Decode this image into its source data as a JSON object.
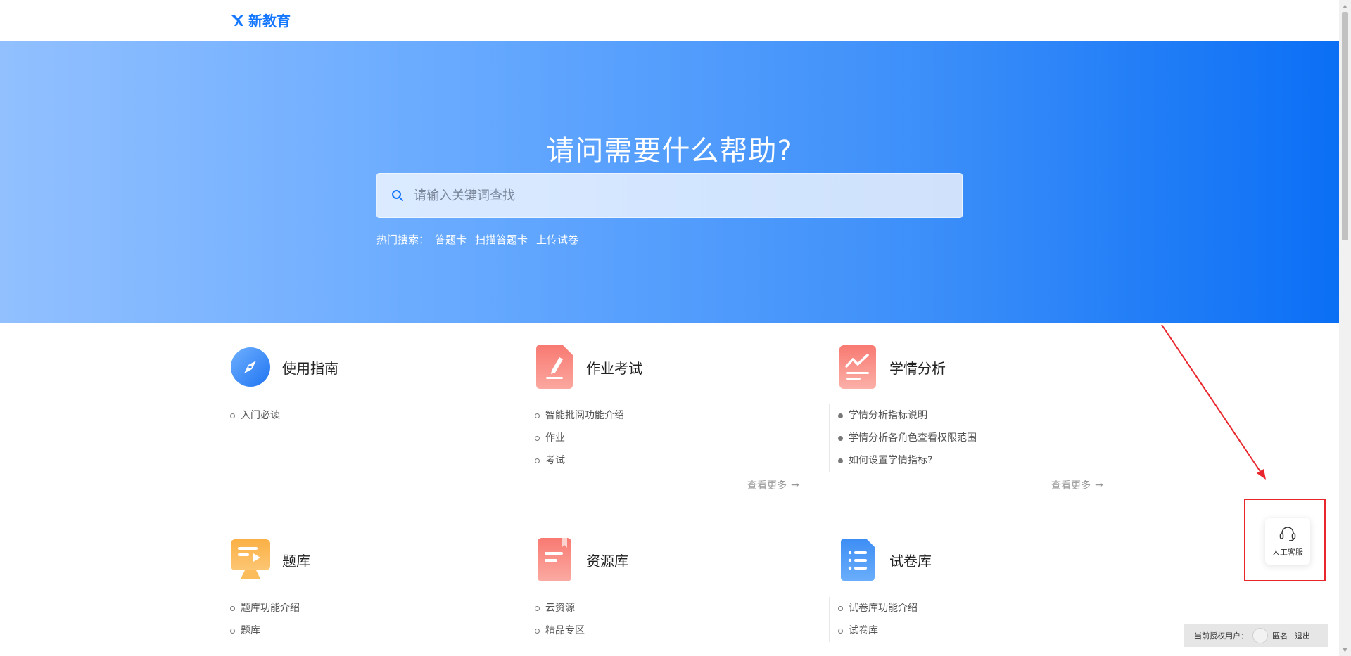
{
  "brand": {
    "name": "新教育"
  },
  "hero": {
    "title": "请问需要什么帮助?",
    "search_placeholder": "请输入关键词查找",
    "hot_label": "热门搜索：",
    "hot_terms": [
      "答题卡",
      "扫描答题卡",
      "上传试卷"
    ]
  },
  "categories": [
    {
      "title": "使用指南",
      "icon": "compass-icon",
      "items": [
        "入门必读"
      ]
    },
    {
      "title": "作业考试",
      "icon": "edit-document-icon",
      "items": [
        "智能批阅功能介绍",
        "作业",
        "考试"
      ],
      "more": "查看更多"
    },
    {
      "title": "学情分析",
      "icon": "chart-analysis-icon",
      "items": [
        "学情分析指标说明",
        "学情分析各角色查看权限范围",
        "如何设置学情指标?"
      ],
      "more": "查看更多"
    },
    {
      "title": "题库",
      "icon": "question-bank-icon",
      "items": [
        "题库功能介绍",
        "题库"
      ]
    },
    {
      "title": "资源库",
      "icon": "resource-icon",
      "items": [
        "云资源",
        "精品专区"
      ]
    },
    {
      "title": "试卷库",
      "icon": "paper-list-icon",
      "items": [
        "试卷库功能介绍",
        "试卷库"
      ]
    }
  ],
  "service": {
    "label": "人工客服",
    "icon": "headset-icon"
  },
  "user_bar": {
    "label": "当前授权用户：",
    "name": "匿名",
    "logout": "退出"
  },
  "colors": {
    "brand": "#1677ff",
    "highlight": "#e8262c"
  }
}
